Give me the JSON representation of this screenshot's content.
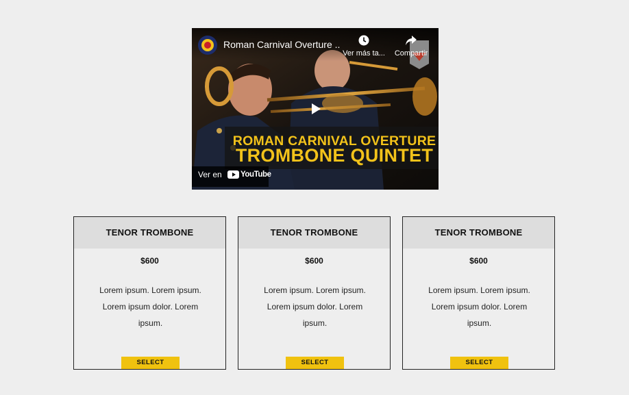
{
  "video": {
    "title": "Roman Carnival Overture ...",
    "watch_later_label": "Ver más ta...",
    "share_label": "Compartir",
    "headline_line1": "ROMAN CARNIVAL OVERTURE",
    "headline_line2": "TROMBONE QUINTET",
    "watch_on_label": "Ver en",
    "youtube_label": "YouTube",
    "accent_color": "#f2c21a"
  },
  "products": [
    {
      "name": "TENOR TROMBONE",
      "price": "$600",
      "description": "Lorem ipsum. Lorem ipsum. Lorem ipsum dolor. Lorem ipsum.",
      "button_label": "SELECT"
    },
    {
      "name": "TENOR TROMBONE",
      "price": "$600",
      "description": "Lorem ipsum. Lorem ipsum. Lorem ipsum dolor. Lorem ipsum.",
      "button_label": "SELECT"
    },
    {
      "name": "TENOR TROMBONE",
      "price": "$600",
      "description": "Lorem ipsum. Lorem ipsum. Lorem ipsum dolor. Lorem ipsum.",
      "button_label": "SELECT"
    }
  ],
  "colors": {
    "page_background": "#eeeeee",
    "card_header_background": "#dddddd",
    "button_background": "#f0c20f"
  }
}
